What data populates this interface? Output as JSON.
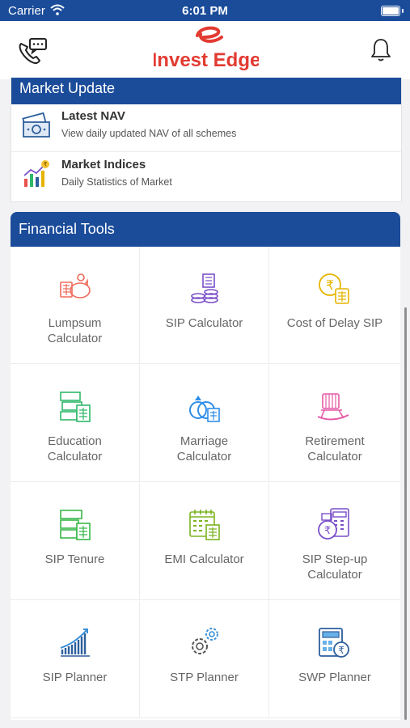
{
  "status": {
    "carrier": "Carrier",
    "time": "6:01 PM"
  },
  "header": {
    "logo_text": "Invest Edge"
  },
  "market_update": {
    "title": "Market Update",
    "items": [
      {
        "title": "Latest NAV",
        "subtitle": "View daily updated NAV of all schemes",
        "icon": "money-icon"
      },
      {
        "title": "Market Indices",
        "subtitle": "Daily Statistics of Market",
        "icon": "chart-icon"
      }
    ]
  },
  "financial_tools": {
    "title": "Financial Tools",
    "tools": [
      {
        "l1": "Lumpsum",
        "l2": "Calculator",
        "icon": "piggy-bank-icon",
        "color": "#f06a5b"
      },
      {
        "l1": "SIP Calculator",
        "l2": "",
        "icon": "coins-icon",
        "color": "#7a4fc9"
      },
      {
        "l1": "Cost of Delay SIP",
        "l2": "",
        "icon": "rupee-clock-icon",
        "color": "#e6b400"
      },
      {
        "l1": "Education",
        "l2": "Calculator",
        "icon": "education-icon",
        "color": "#2fb86a"
      },
      {
        "l1": "Marriage",
        "l2": "Calculator",
        "icon": "rings-icon",
        "color": "#2f8ee8"
      },
      {
        "l1": "Retirement",
        "l2": "Calculator",
        "icon": "rocking-chair-icon",
        "color": "#e65aa6"
      },
      {
        "l1": "SIP Tenure",
        "l2": "",
        "icon": "tenure-icon",
        "color": "#38b74a"
      },
      {
        "l1": "EMI Calculator",
        "l2": "",
        "icon": "calendar-icon",
        "color": "#7cb321"
      },
      {
        "l1": "SIP Step-up",
        "l2": "Calculator",
        "icon": "step-up-icon",
        "color": "#7a4fc9"
      },
      {
        "l1": "SIP Planner",
        "l2": "",
        "icon": "growth-chart-icon",
        "color": "#2d5f9c"
      },
      {
        "l1": "STP Planner",
        "l2": "",
        "icon": "gears-icon",
        "color": "#3a8fd6"
      },
      {
        "l1": "SWP Planner",
        "l2": "",
        "icon": "calculator-icon",
        "color": "#2d5f9c"
      }
    ]
  }
}
